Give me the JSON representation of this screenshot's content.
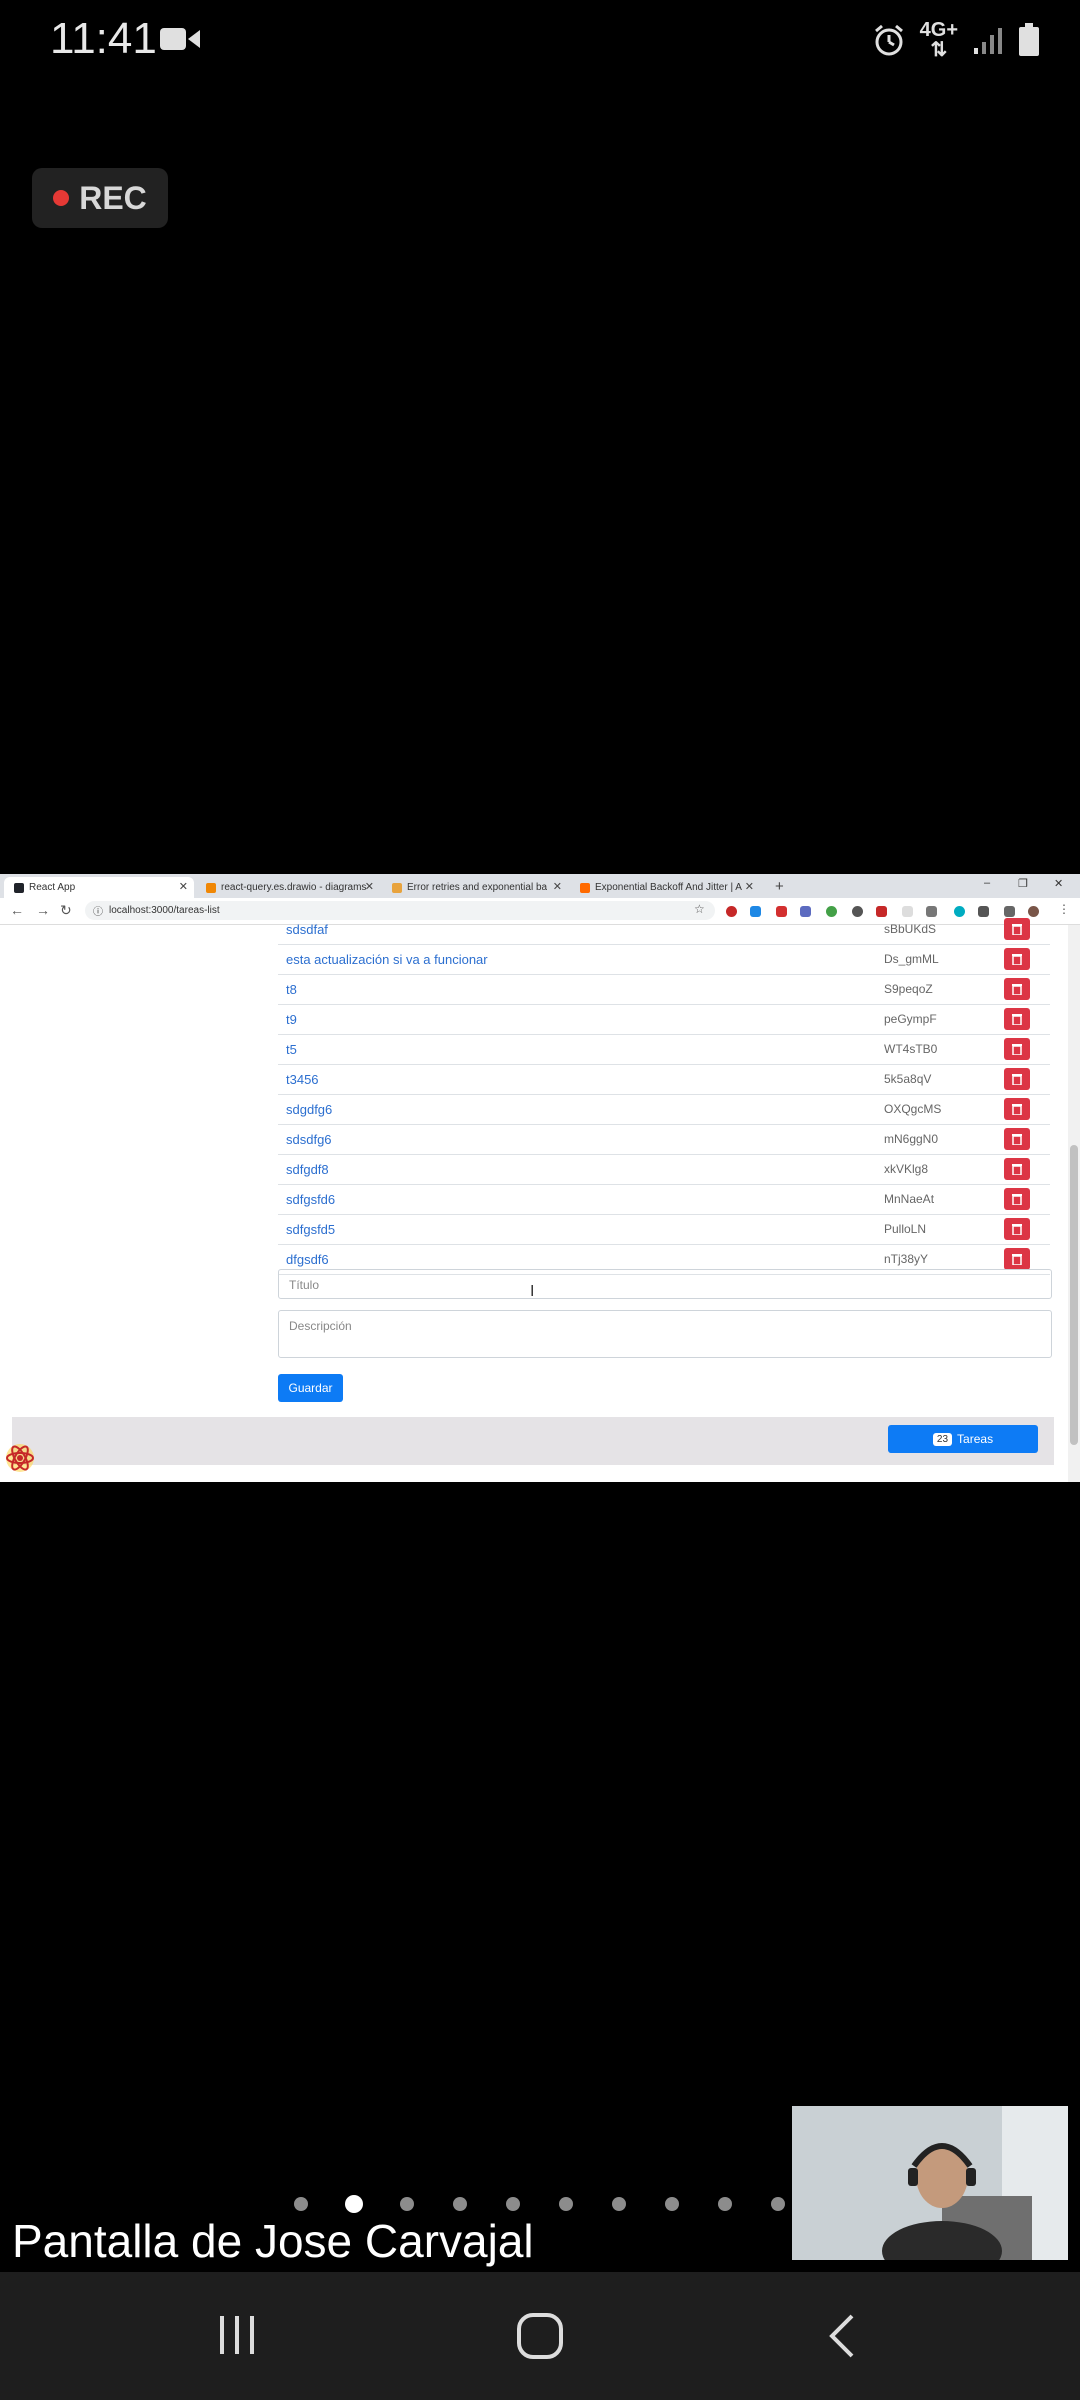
{
  "status_bar": {
    "time": "11:41",
    "network": "4G+"
  },
  "recording": {
    "label": "REC"
  },
  "browser": {
    "tabs": [
      {
        "title": "React App",
        "active": true,
        "favicon_color": "#20232a"
      },
      {
        "title": "react-query.es.drawio - diagrams",
        "active": false,
        "favicon_color": "#f08705"
      },
      {
        "title": "Error retries and exponential ba",
        "active": false,
        "favicon_color": "#e8a33d"
      },
      {
        "title": "Exponential Backoff And Jitter | A",
        "active": false,
        "favicon_color": "#ff6a00"
      }
    ],
    "url": "localhost:3000/tareas-list"
  },
  "app": {
    "tasks": [
      {
        "title": "sdsdfaf",
        "id": "sBbUKdS"
      },
      {
        "title": "esta actualización si va a funcionar",
        "id": "Ds_gmML"
      },
      {
        "title": "t8",
        "id": "S9peqoZ"
      },
      {
        "title": "t9",
        "id": "peGympF"
      },
      {
        "title": "t5",
        "id": "WT4sTB0"
      },
      {
        "title": "t3456",
        "id": "5k5a8qV"
      },
      {
        "title": "sdgdfg6",
        "id": "OXQgcMS"
      },
      {
        "title": "sdsdfg6",
        "id": "mN6ggN0"
      },
      {
        "title": "sdfgdf8",
        "id": "xkVKlg8"
      },
      {
        "title": "sdfgsfd6",
        "id": "MnNaeAt"
      },
      {
        "title": "sdfgsfd5",
        "id": "PulloLN"
      },
      {
        "title": "dfgsdf6",
        "id": "nTj38yY"
      }
    ],
    "form": {
      "title_placeholder": "Título",
      "description_placeholder": "Descripción",
      "save_label": "Guardar"
    },
    "footer": {
      "count": "23",
      "label": "Tareas"
    }
  },
  "meeting": {
    "presenter_label": "Pantalla de Jose Carvajal",
    "page_count": 10,
    "active_page": 2
  },
  "colors": {
    "danger": "#dc3545",
    "primary": "#0d7bf5",
    "link": "#2c6fd0"
  }
}
